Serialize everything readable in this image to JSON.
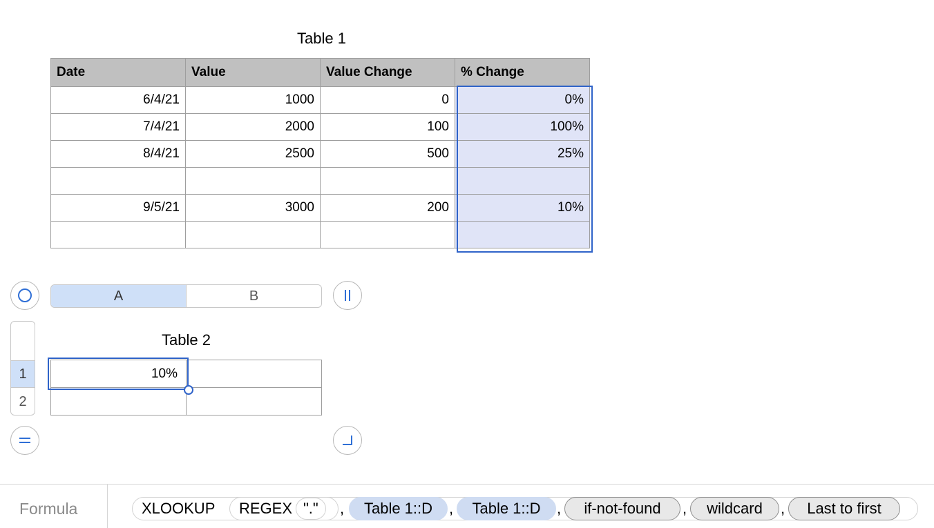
{
  "table1": {
    "title": "Table 1",
    "headers": [
      "Date",
      "Value",
      "Value Change",
      "% Change"
    ],
    "rows": [
      [
        "6/4/21",
        "1000",
        "0",
        "0%"
      ],
      [
        "7/4/21",
        "2000",
        "100",
        "100%"
      ],
      [
        "8/4/21",
        "2500",
        "500",
        "25%"
      ],
      [
        "",
        "",
        "",
        ""
      ],
      [
        "9/5/21",
        "3000",
        "200",
        "10%"
      ],
      [
        "",
        "",
        "",
        ""
      ]
    ]
  },
  "table2": {
    "title": "Table 2",
    "column_headers": [
      "A",
      "B"
    ],
    "row_headers": [
      "1",
      "2"
    ],
    "rows": [
      [
        "10%",
        ""
      ],
      [
        "",
        ""
      ]
    ]
  },
  "formula_bar": {
    "label": "Formula",
    "tokens": {
      "fn1": "XLOOKUP",
      "fn2": "REGEX",
      "arg_text": "\".\"",
      "ref1": "Table 1::D",
      "ref2": "Table 1::D",
      "opt1": "if-not-found",
      "opt2": "wildcard",
      "opt3": "Last to first"
    },
    "comma": ","
  },
  "icons": {
    "select-all": "circle-icon",
    "column-resize": "column-handle-icon",
    "row-resize": "equals-icon",
    "corner-resize": "corner-icon"
  },
  "colors": {
    "selection": "#2f63c9",
    "selected_fill": "#e0e4f7",
    "header_fill": "#c0c0c0",
    "reference_token": "#cfdcf2"
  }
}
